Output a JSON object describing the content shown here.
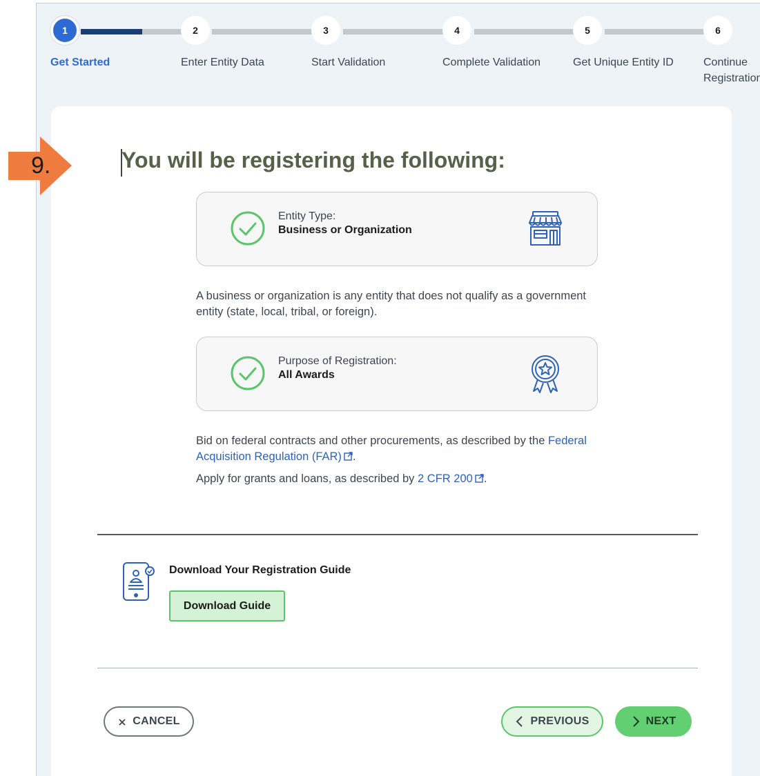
{
  "steps": [
    {
      "number": "1",
      "label": "Get Started",
      "active": true
    },
    {
      "number": "2",
      "label": "Enter Entity Data"
    },
    {
      "number": "3",
      "label": "Start Validation"
    },
    {
      "number": "4",
      "label": "Complete Validation"
    },
    {
      "number": "5",
      "label": "Get Unique Entity ID"
    },
    {
      "number": "6",
      "label_line1": "Continue",
      "label_line2": "Registration"
    }
  ],
  "step_progress": 0.6,
  "page": {
    "title": "You will be registering the following:"
  },
  "entity_type": {
    "label": "Entity Type:",
    "value": "Business or Organization",
    "icon": "storefront-icon",
    "description": "A business or organization is any entity that does not qualify as a government entity (state, local, tribal, or foreign)."
  },
  "purpose": {
    "label": "Purpose of Registration:",
    "value": "All Awards",
    "icon": "award-ribbon-icon",
    "text1_before": "Bid on federal contracts and other procurements, as described by the ",
    "text1_link": "Federal Acquisition Regulation (FAR)",
    "text1_after": ".",
    "text2_before": "Apply for grants and loans, as described by ",
    "text2_link": "2 CFR 200",
    "text2_after": "."
  },
  "guide": {
    "title": "Download Your Registration Guide",
    "button": "Download Guide"
  },
  "buttons": {
    "cancel": "CANCEL",
    "previous": "PREVIOUS",
    "next": "NEXT"
  },
  "annotation": {
    "step_number": "9."
  },
  "colors": {
    "active_step": "#2e6ad4",
    "progress_fill": "#1a3d73",
    "check_green": "#5cc46a",
    "next_button": "#62cf72",
    "link": "#2d62b8",
    "callout": "#f07b3f"
  }
}
